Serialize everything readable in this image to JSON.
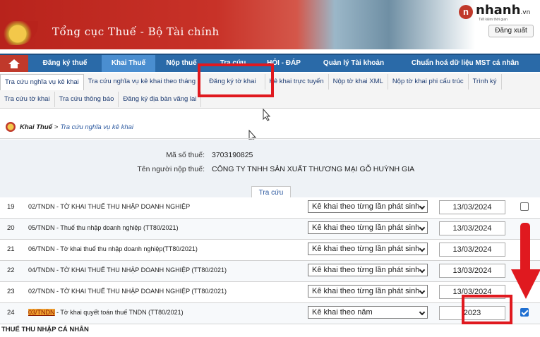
{
  "banner": {
    "title": "Tổng cục Thuế - Bộ Tài chính",
    "logout_label": "Đăng xuất"
  },
  "watermark": {
    "brand": "nhanh",
    "tld": ".vn",
    "tagline": "Tiết kiệm thời gian"
  },
  "mainnav": {
    "items": [
      {
        "label": "Đăng ký thuế"
      },
      {
        "label": "Khai Thuế"
      },
      {
        "label": "Nộp thuế"
      },
      {
        "label": "Tra cứu"
      },
      {
        "label": "HỎI - ĐÁP"
      },
      {
        "label": "Quản lý Tài khoản"
      },
      {
        "label": "Chuẩn hoá dữ liệu MST cá nhân"
      }
    ]
  },
  "subnav": {
    "row1": [
      {
        "label": "Tra cứu nghĩa vụ kê khai"
      },
      {
        "label": "Tra cứu nghĩa vụ kê khai theo tháng"
      },
      {
        "label": "Đăng ký tờ khai"
      },
      {
        "label": "Kê khai trực tuyến"
      },
      {
        "label": "Nộp tờ khai XML"
      },
      {
        "label": "Nộp tờ khai phi cấu trúc"
      },
      {
        "label": "Trình ký"
      }
    ],
    "row2": [
      {
        "label": "Tra cứu tờ khai"
      },
      {
        "label": "Tra cứu thông báo"
      },
      {
        "label": "Đăng ký địa bàn vãng lai"
      }
    ]
  },
  "breadcrumb": {
    "parent": "Khai Thuế",
    "separator": ">",
    "current": "Tra cứu nghĩa vụ kê khai"
  },
  "taxpayer": {
    "mst_label": "Mã số thuế:",
    "mst_value": "3703190825",
    "name_label": "Tên người nộp thuế:",
    "name_value": "CÔNG TY TNHH SẢN XUẤT THƯƠNG MẠI GỖ HUỲNH GIA"
  },
  "search_tab": "Tra cứu",
  "table": {
    "rows": [
      {
        "no": "19",
        "name_pre": "",
        "name_hl": "",
        "name": "02/TNDN - TỜ KHAI THUẾ THU NHẬP DOANH NGHIỆP",
        "period": "Kê khai theo từng lần phát sinh",
        "date": "13/03/2024",
        "checked": false
      },
      {
        "no": "20",
        "name_pre": "",
        "name_hl": "",
        "name": "05/TNDN - Thuế thu nhập doanh nghiệp (TT80/2021)",
        "period": "Kê khai theo từng lần phát sinh",
        "date": "13/03/2024",
        "checked": false
      },
      {
        "no": "21",
        "name_pre": "",
        "name_hl": "",
        "name": "06/TNDN - Tờ khai thuế thu nhập doanh nghiệp(TT80/2021)",
        "period": "Kê khai theo từng lần phát sinh",
        "date": "13/03/2024",
        "checked": false
      },
      {
        "no": "22",
        "name_pre": "",
        "name_hl": "",
        "name": "04/TNDN - TỜ KHAI THUẾ THU NHẬP DOANH NGHIỆP (TT80/2021)",
        "period": "Kê khai theo từng lần phát sinh",
        "date": "13/03/2024",
        "checked": false
      },
      {
        "no": "23",
        "name_pre": "",
        "name_hl": "",
        "name": "02/TNDN - TỜ KHAI THUẾ THU NHẬP DOANH NGHIỆP (TT80/2021)",
        "period": "Kê khai theo từng lần phát sinh",
        "date": "13/03/2024",
        "checked": false
      },
      {
        "no": "24",
        "name_pre": "",
        "name_hl": "03/TNDN",
        "name": " - Tờ khai quyết toán thuế TNDN (TT80/2021)",
        "period": "Kê khai theo năm",
        "date": "2023",
        "checked": true
      }
    ]
  },
  "section_title": "THUẾ THU NHẬP CÁ NHÂN",
  "colors": {
    "nav_blue": "#2a6aa8",
    "nav_active": "#4a8ed0",
    "highlight_red": "#e0191f",
    "banner_red": "#b8231c"
  }
}
